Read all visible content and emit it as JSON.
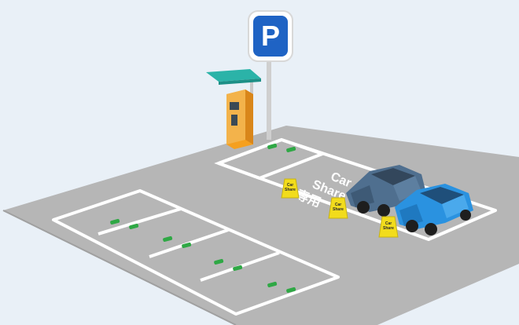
{
  "sign": {
    "letter": "P",
    "bg_color": "#1f63c4"
  },
  "ground_text": {
    "line1": "Car",
    "line2": "Share",
    "line3": "専用"
  },
  "cones": [
    {
      "line1": "Car",
      "line2": "Share"
    },
    {
      "line1": "Car",
      "line2": "Share"
    },
    {
      "line1": "Car",
      "line2": "Share"
    }
  ],
  "cars": [
    {
      "name": "dark-blue-car",
      "color": "#4f6f8f"
    },
    {
      "name": "light-blue-car",
      "color": "#2a92e0"
    }
  ],
  "colors": {
    "asphalt": "#b4b4b4",
    "lines": "#ffffff",
    "wheel_stop": "#2fa845",
    "kiosk": "#f5a01f",
    "canopy": "#2bb3a8",
    "cone": "#f2dc1c"
  }
}
